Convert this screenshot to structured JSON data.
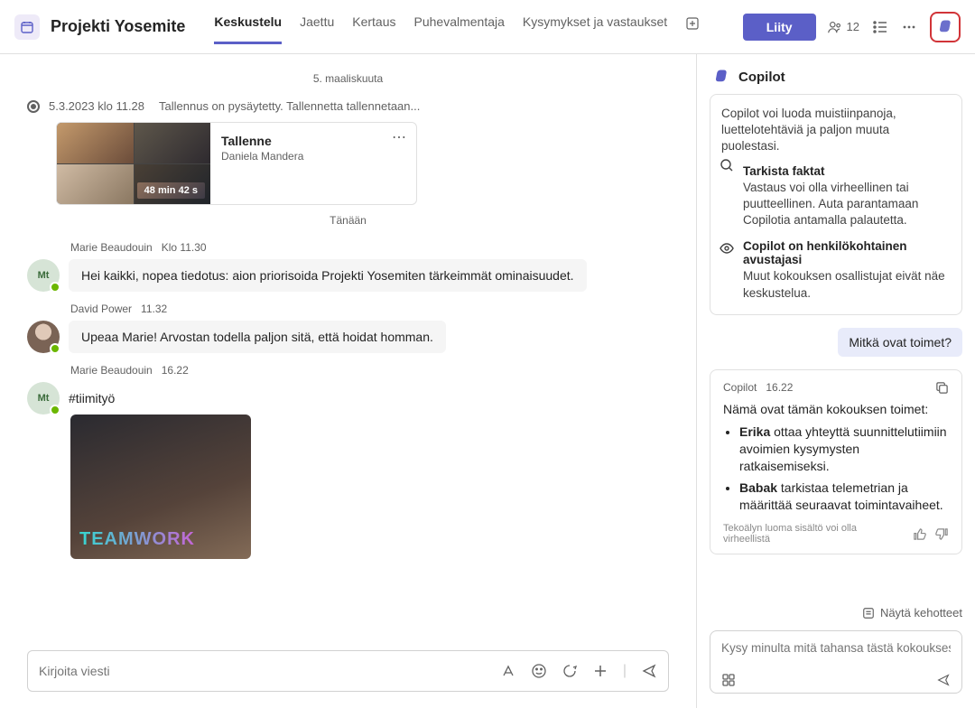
{
  "header": {
    "title": "Projekti Yosemite",
    "tabs": [
      "Keskustelu",
      "Jaettu",
      "Kertaus",
      "Puhevalmentaja",
      "Kysymykset ja vastaukset"
    ],
    "active_tab": 0,
    "join_label": "Liity",
    "participants": "12"
  },
  "chat": {
    "date1": "5. maaliskuuta",
    "sys_time": "5.3.2023 klo 11.28",
    "sys_text": "Tallennus on pysäytetty. Tallennetta tallennetaan...",
    "recording": {
      "title": "Tallenne",
      "subtitle": "Daniela Mandera",
      "duration": "48 min 42 s"
    },
    "date2": "Tänään",
    "m1_author": "Marie Beaudouin",
    "m1_time": "Klo 11.30",
    "m1_text": "Hei kaikki, nopea tiedotus: aion priorisoida Projekti Yosemiten tärkeimmät ominaisuudet.",
    "m2_author": "David Power",
    "m2_time": "11.32",
    "m2_text": "Upeaa Marie! Arvostan todella paljon sitä, että hoidat homman.",
    "m3_author": "Marie Beaudouin",
    "m3_time": "16.22",
    "m3_text": "#tiimityö",
    "gif_text": "TEAMWORK",
    "compose_placeholder": "Kirjoita viesti"
  },
  "copilot": {
    "title": "Copilot",
    "intro": "Copilot voi luoda muistiinpanoja, luettelotehtäviä ja paljon muuta puolestasi.",
    "facts_title": "Tarkista faktat",
    "facts_body": "Vastaus voi olla virheellinen tai puutteellinen. Auta parantamaan Copilotia antamalla palautetta.",
    "pers_title": "Copilot on henkilökohtainen avustajasi",
    "pers_body": "Muut kokouksen osallistujat eivät näe keskustelua.",
    "user_msg": "Mitkä ovat toimet?",
    "reply_name": "Copilot",
    "reply_time": "16.22",
    "reply_intro": "Nämä ovat tämän kokouksen toimet:",
    "reply_items": [
      {
        "name": "Erika",
        "text": " ottaa yhteyttä suunnittelutiimiin avoimien kysymysten ratkaisemiseksi."
      },
      {
        "name": "Babak",
        "text": " tarkistaa telemetrian ja määrittää seuraavat toimintavaiheet."
      }
    ],
    "disclaimer": "Tekoälyn luoma sisältö voi olla virheellistä",
    "show_prompts": "Näytä kehotteet",
    "input_placeholder": "Kysy minulta mitä tahansa tästä kokouksesta"
  }
}
